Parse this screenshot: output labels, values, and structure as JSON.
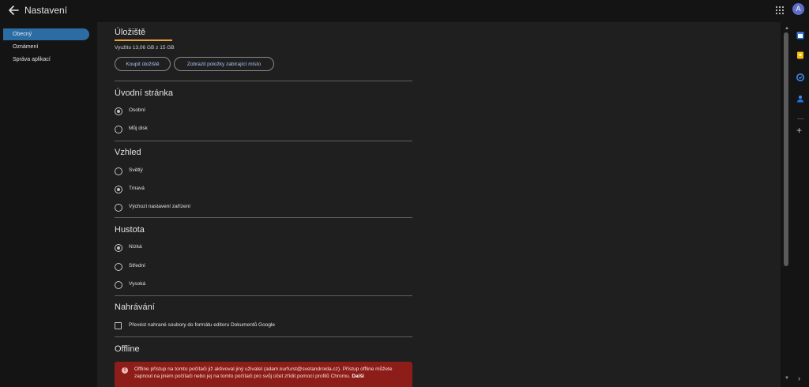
{
  "header": {
    "title": "Nastavení",
    "avatar_letter": "A"
  },
  "sidebar": {
    "items": [
      {
        "label": "Obecný",
        "active": true
      },
      {
        "label": "Oznámení",
        "active": false
      },
      {
        "label": "Správa aplikací",
        "active": false
      }
    ]
  },
  "storage": {
    "title": "Úložiště",
    "usage": "Využito 13,06 GB z 15 GB",
    "buy_button": "Koupit úložiště",
    "view_button": "Zobrazit položky zabírající místo"
  },
  "home_page": {
    "title": "Úvodní stránka",
    "options": [
      {
        "label": "Osobní",
        "checked": true
      },
      {
        "label": "Můj disk",
        "checked": false
      }
    ]
  },
  "appearance": {
    "title": "Vzhled",
    "options": [
      {
        "label": "Světlý",
        "checked": false
      },
      {
        "label": "Tmavá",
        "checked": true
      },
      {
        "label": "Výchozí nastavení zařízení",
        "checked": false
      }
    ]
  },
  "density": {
    "title": "Hustota",
    "options": [
      {
        "label": "Nízká",
        "checked": true
      },
      {
        "label": "Střední",
        "checked": false
      },
      {
        "label": "Vysoká",
        "checked": false
      }
    ]
  },
  "upload": {
    "title": "Nahrávání",
    "convert_label": "Převést nahrané soubory do formátu editoru Dokumentů Google",
    "convert_checked": false
  },
  "offline": {
    "title": "Offline",
    "alert_text": "Offline přístup na tomto počítači již aktivoval jiný uživatel (adam.kurfurst@svetandroida.cz). Přístup offline můžete zapnout na jiném počítači nebo jej na tomto počítači pro svůj účet zřídit pomocí profilů Chromu.",
    "alert_link": "Další"
  },
  "colors": {
    "accent_active": "#2b6ca3",
    "storage_bar": "#e8a33d",
    "alert_bg": "#8c1d18",
    "link": "#a8c7fa"
  },
  "icons": [
    "arrow-back-icon",
    "apps-grid-icon",
    "calendar-icon",
    "keep-icon",
    "tasks-icon",
    "contacts-icon",
    "plus-icon",
    "chevron-right-icon",
    "error-icon"
  ]
}
